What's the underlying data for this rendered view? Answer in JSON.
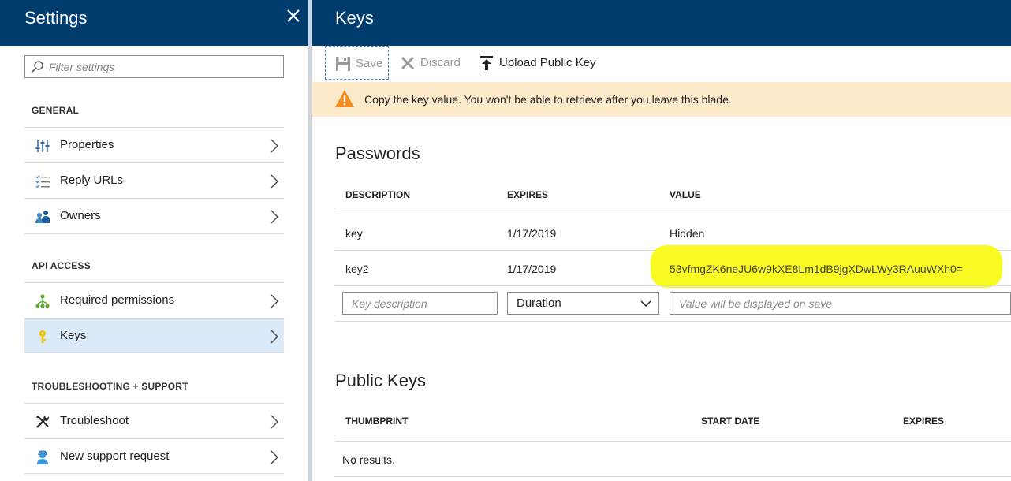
{
  "settings_blade": {
    "title": "Settings",
    "filter_placeholder": "Filter settings",
    "sections": {
      "general": "GENERAL",
      "api_access": "API ACCESS",
      "troubleshooting": "TROUBLESHOOTING + SUPPORT"
    },
    "items": {
      "properties": "Properties",
      "reply_urls": "Reply URLs",
      "owners": "Owners",
      "required_permissions": "Required permissions",
      "keys": "Keys",
      "troubleshoot": "Troubleshoot",
      "new_support_request": "New support request"
    },
    "selected_item": "keys"
  },
  "keys_blade": {
    "title": "Keys",
    "toolbar": {
      "save": "Save",
      "discard": "Discard",
      "upload": "Upload Public Key"
    },
    "warning": "Copy the key value. You won't be able to retrieve after you leave this blade.",
    "passwords": {
      "heading": "Passwords",
      "columns": [
        "DESCRIPTION",
        "EXPIRES",
        "VALUE"
      ],
      "rows": [
        {
          "description": "key",
          "expires": "1/17/2019",
          "value": "Hidden"
        },
        {
          "description": "key2",
          "expires": "1/17/2019",
          "value": "53vfmgZK6neJU6w9kXE8Lm1dB9jgXDwLWy3RAuuWXh0="
        }
      ],
      "new_row": {
        "description_placeholder": "Key description",
        "duration_value": "Duration",
        "value_placeholder": "Value will be displayed on save"
      }
    },
    "public_keys": {
      "heading": "Public Keys",
      "columns": [
        "THUMBPRINT",
        "START DATE",
        "EXPIRES"
      ],
      "empty_text": "No results."
    }
  },
  "colors": {
    "header_bg": "#003d6e",
    "selected_bg": "#dbeaf9",
    "warning_bg": "#fceacb",
    "warning_icon": "#f28c1b",
    "highlight": "#fafa23"
  }
}
